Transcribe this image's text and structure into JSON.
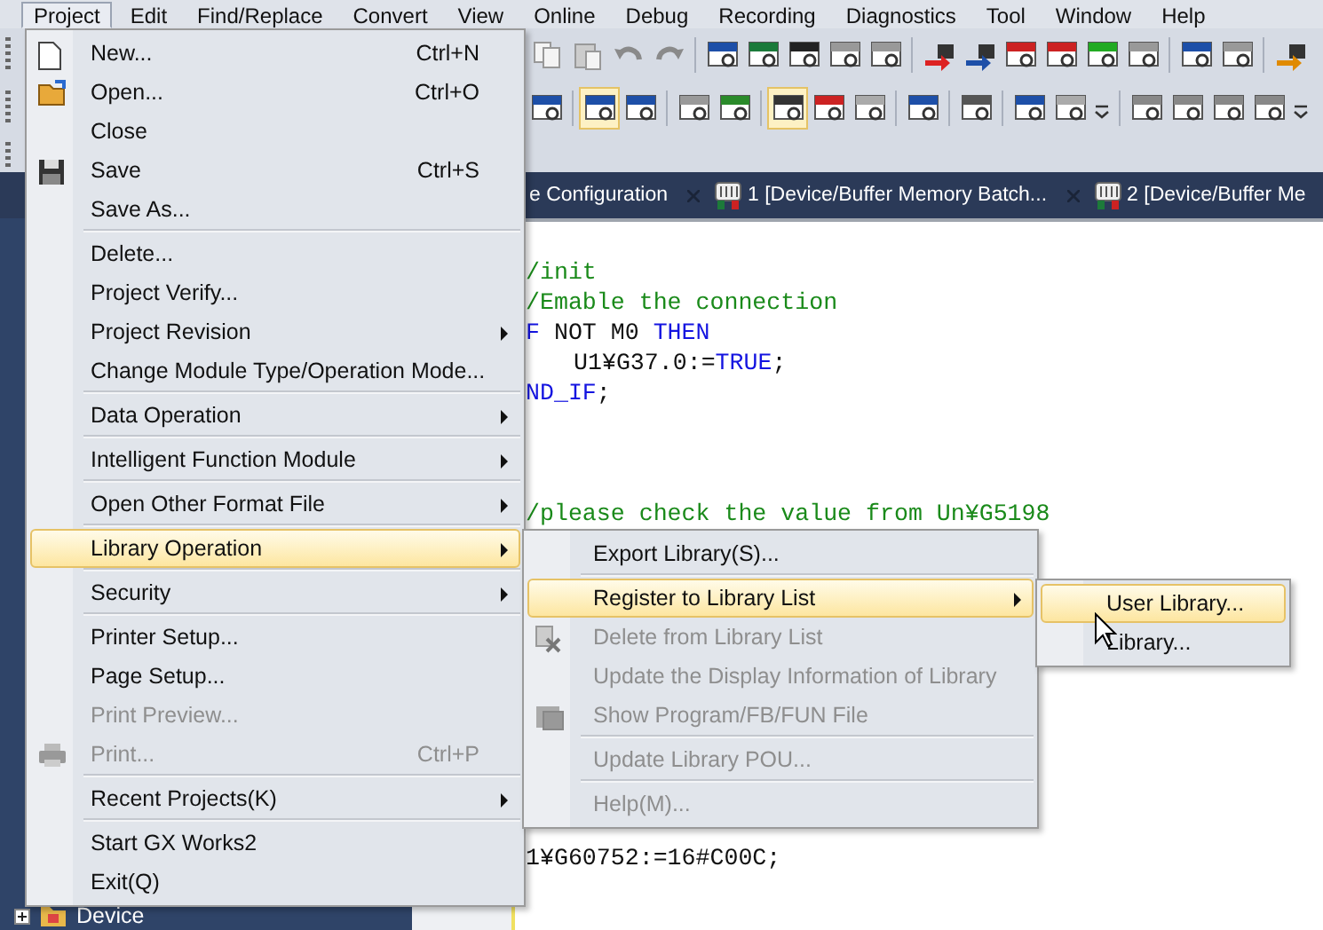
{
  "menu_bar": [
    {
      "label": "Project",
      "selected": true
    },
    {
      "label": "Edit",
      "selected": false
    },
    {
      "label": "Find/Replace",
      "selected": false
    },
    {
      "label": "Convert",
      "selected": false
    },
    {
      "label": "View",
      "selected": false
    },
    {
      "label": "Online",
      "selected": false
    },
    {
      "label": "Debug",
      "selected": false
    },
    {
      "label": "Recording",
      "selected": false
    },
    {
      "label": "Diagnostics",
      "selected": false
    },
    {
      "label": "Tool",
      "selected": false
    },
    {
      "label": "Window",
      "selected": false
    },
    {
      "label": "Help",
      "selected": false
    }
  ],
  "tabs": [
    {
      "label": "e Configuration",
      "selected": false
    },
    {
      "label": "1 [Device/Buffer Memory Batch...",
      "selected": false
    },
    {
      "label": "2 [Device/Buffer Me",
      "selected": false
    }
  ],
  "navigation": {
    "items": [
      {
        "label": "Device",
        "expanded": false
      }
    ]
  },
  "editor": {
    "blocks": [
      [
        {
          "kind": "plain",
          "segments": [
            {
              "text": "/init",
              "kind": "comment"
            }
          ]
        },
        {
          "kind": "plain",
          "segments": [
            {
              "text": "/Emable the connection",
              "kind": "comment"
            }
          ]
        },
        {
          "kind": "plain",
          "segments": [
            {
              "text": "F",
              "kind": "keyword"
            },
            {
              "text": " NOT M0 ",
              "kind": "plain"
            },
            {
              "text": "THEN",
              "kind": "keyword"
            }
          ]
        },
        {
          "kind": "indented",
          "segments": [
            {
              "text": "U1¥G37.0:=",
              "kind": "plain"
            },
            {
              "text": "TRUE",
              "kind": "keyword"
            },
            {
              "text": ";",
              "kind": "plain"
            }
          ]
        },
        {
          "kind": "plain",
          "segments": [
            {
              "text": "ND_IF",
              "kind": "keyword"
            },
            {
              "text": ";",
              "kind": "plain"
            }
          ]
        }
      ],
      [
        {
          "kind": "plain",
          "segments": [
            {
              "text": "/please check the value from Un¥G5198",
              "kind": "comment"
            }
          ]
        }
      ],
      [
        {
          "kind": "plain",
          "segments": [
            {
              "text": "1¥G60752:=16#C00C;",
              "kind": "plain"
            }
          ]
        }
      ]
    ]
  },
  "project_menu": {
    "groups": [
      [
        {
          "label": "New...",
          "shortcut": "Ctrl+N",
          "submenu": false,
          "disabled": false,
          "selected": false
        },
        {
          "label": "Open...",
          "shortcut": "Ctrl+O",
          "submenu": false,
          "disabled": false,
          "selected": false
        },
        {
          "label": "Close",
          "submenu": false,
          "disabled": false,
          "selected": false
        },
        {
          "label": "Save",
          "shortcut": "Ctrl+S",
          "submenu": false,
          "disabled": false,
          "selected": false
        },
        {
          "label": "Save As...",
          "submenu": false,
          "disabled": false,
          "selected": false
        }
      ],
      [
        {
          "label": "Delete...",
          "submenu": false,
          "disabled": false,
          "selected": false
        },
        {
          "label": "Project Verify...",
          "submenu": false,
          "disabled": false,
          "selected": false
        },
        {
          "label": "Project Revision",
          "submenu": true,
          "disabled": false,
          "selected": false
        },
        {
          "label": "Change Module Type/Operation Mode...",
          "submenu": false,
          "disabled": false,
          "selected": false
        }
      ],
      [
        {
          "label": "Data Operation",
          "submenu": true,
          "disabled": false,
          "selected": false
        }
      ],
      [
        {
          "label": "Intelligent Function Module",
          "submenu": true,
          "disabled": false,
          "selected": false
        }
      ],
      [
        {
          "label": "Open Other Format File",
          "submenu": true,
          "disabled": false,
          "selected": false
        }
      ],
      [
        {
          "label": "Library Operation",
          "submenu": true,
          "disabled": false,
          "selected": true
        }
      ],
      [
        {
          "label": "Security",
          "submenu": true,
          "disabled": false,
          "selected": false
        }
      ],
      [
        {
          "label": "Printer Setup...",
          "submenu": false,
          "disabled": false,
          "selected": false
        },
        {
          "label": "Page Setup...",
          "submenu": false,
          "disabled": false,
          "selected": false
        },
        {
          "label": "Print Preview...",
          "submenu": false,
          "disabled": true,
          "selected": false
        },
        {
          "label": "Print...",
          "shortcut": "Ctrl+P",
          "submenu": false,
          "disabled": true,
          "selected": false
        }
      ],
      [
        {
          "label": "Recent Projects(K)",
          "submenu": true,
          "disabled": false,
          "selected": false
        }
      ],
      [
        {
          "label": "Start GX Works2",
          "submenu": false,
          "disabled": false,
          "selected": false
        },
        {
          "label": "Exit(Q)",
          "submenu": false,
          "disabled": false,
          "selected": false
        }
      ]
    ]
  },
  "library_operation_menu": {
    "groups": [
      [
        {
          "label": "Export Library(S)...",
          "submenu": false,
          "disabled": false,
          "selected": false
        }
      ],
      [
        {
          "label": "Register to Library List",
          "submenu": true,
          "disabled": false,
          "selected": true
        },
        {
          "label": "Delete from Library List",
          "submenu": false,
          "disabled": true,
          "selected": false
        },
        {
          "label": "Update the Display Information of Library",
          "submenu": false,
          "disabled": true,
          "selected": false
        },
        {
          "label": "Show Program/FB/FUN File",
          "submenu": false,
          "disabled": true,
          "selected": false
        }
      ],
      [
        {
          "label": "Update Library POU...",
          "submenu": false,
          "disabled": true,
          "selected": false
        }
      ],
      [
        {
          "label": "Help(M)...",
          "submenu": false,
          "disabled": true,
          "selected": false
        }
      ]
    ]
  },
  "register_submenu": {
    "groups": [
      [
        {
          "label": "User Library...",
          "submenu": false,
          "disabled": false,
          "selected": true
        },
        {
          "label": "Library...",
          "submenu": false,
          "disabled": false,
          "selected": false
        }
      ]
    ]
  }
}
